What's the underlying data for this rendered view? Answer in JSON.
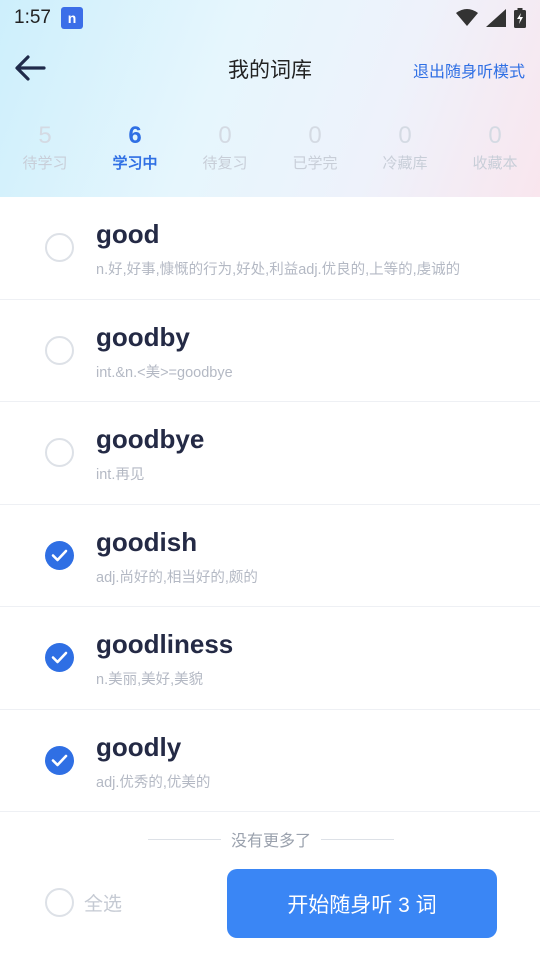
{
  "status_bar": {
    "time": "1:57",
    "app_badge": "n"
  },
  "nav": {
    "title": "我的词库",
    "exit_label": "退出随身听模式"
  },
  "stats": [
    {
      "count": "5",
      "label": "待学习",
      "active": false
    },
    {
      "count": "6",
      "label": "学习中",
      "active": true
    },
    {
      "count": "0",
      "label": "待复习",
      "active": false
    },
    {
      "count": "0",
      "label": "已学完",
      "active": false
    },
    {
      "count": "0",
      "label": "冷藏库",
      "active": false
    },
    {
      "count": "0",
      "label": "收藏本",
      "active": false
    }
  ],
  "words": [
    {
      "word": "good",
      "definition": "n.好,好事,慷慨的行为,好处,利益adj.优良的,上等的,虔诚的",
      "checked": false
    },
    {
      "word": "goodby",
      "definition": "int.&n.<美>=goodbye",
      "checked": false
    },
    {
      "word": "goodbye",
      "definition": "int.再见",
      "checked": false
    },
    {
      "word": "goodish",
      "definition": "adj.尚好的,相当好的,颇的",
      "checked": true
    },
    {
      "word": "goodliness",
      "definition": "n.美丽,美好,美貌",
      "checked": true
    },
    {
      "word": "goodly",
      "definition": "adj.优秀的,优美的",
      "checked": true
    }
  ],
  "footer": {
    "no_more": "没有更多了",
    "select_all": "全选",
    "start_button": "开始随身听 3 词"
  },
  "colors": {
    "accent": "#2f6fe4",
    "button": "#3a86f5"
  }
}
